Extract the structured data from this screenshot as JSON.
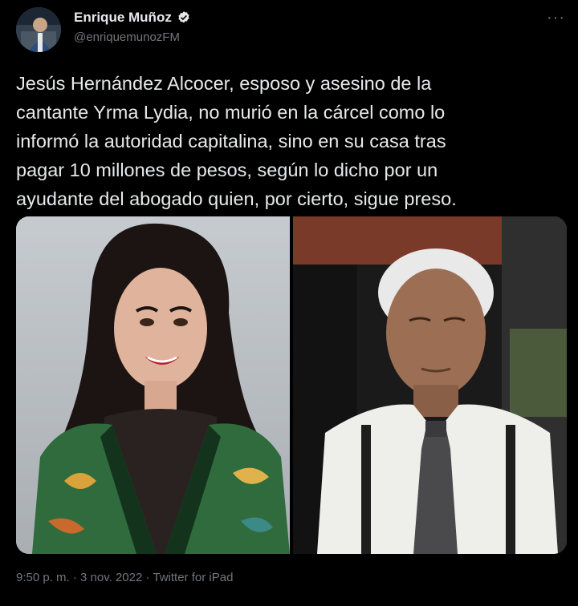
{
  "author": {
    "display_name": "Enrique Muñoz",
    "handle": "@enriquemunozFM",
    "verified": true,
    "avatar_icon": "profile-avatar"
  },
  "menu_icon": "more-options-icon",
  "tweet": {
    "text": "Jesús Hernández Alcocer, esposo y asesino de la\ncantante Yrma Lydia, no murió en la cárcel como lo\ninformó la autoridad capitalina, sino en su casa tras\npagar 10 millones de pesos, según lo dicho por un\nayudante del abogado quien, por cierto, sigue preso.",
    "media": [
      {
        "subject": "woman-portrait-photo"
      },
      {
        "subject": "older-man-portrait-photo"
      }
    ],
    "meta": "9:50 p. m. · 3 nov. 2022 · Twitter for iPad"
  },
  "colors": {
    "background": "#000000",
    "text": "#e7e9ea",
    "secondary": "#71767b",
    "verified": "#e7e9ea"
  }
}
